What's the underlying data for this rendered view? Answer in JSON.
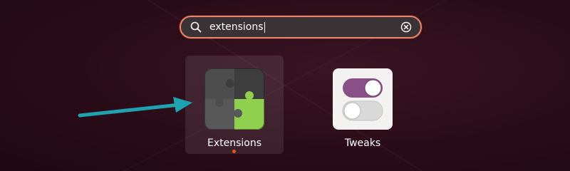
{
  "search": {
    "value": "extensions",
    "icon": "search-icon",
    "clear_icon": "clear-icon"
  },
  "apps": [
    {
      "label": "Extensions",
      "icon": "puzzle-icon",
      "selected": true,
      "running": true
    },
    {
      "label": "Tweaks",
      "icon": "toggle-switches-icon",
      "selected": false,
      "running": false
    }
  ],
  "colors": {
    "accent": "#e95420",
    "search_border": "#e8866d",
    "annotation_arrow": "#1fa3b0",
    "puzzle_dark": "#4a4a4a",
    "puzzle_green": "#8fd14f",
    "toggle_purple": "#8a4f86"
  }
}
